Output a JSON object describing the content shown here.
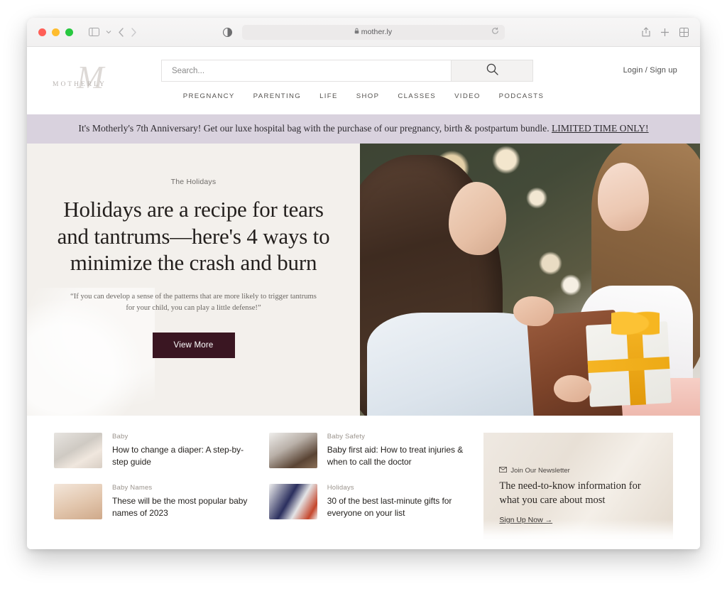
{
  "browser": {
    "url": "mother.ly",
    "lock_icon": "lock-icon",
    "reload_icon": "reload-icon",
    "sidebar_icon": "sidebar-toggle-icon",
    "chevron_icon": "chevron-down-icon",
    "back_icon": "back-arrow-icon",
    "forward_icon": "forward-arrow-icon",
    "shield_icon": "privacy-report-icon",
    "share_icon": "share-icon",
    "new_tab_icon": "plus-icon",
    "tab_overview_icon": "tab-overview-icon"
  },
  "site": {
    "logo": {
      "wordmark": "MOTHERLY",
      "monogram": "M"
    },
    "search": {
      "placeholder": "Search...",
      "value": "",
      "button_icon": "search-icon"
    },
    "account": {
      "label": "Login / Sign up"
    },
    "nav": [
      {
        "label": "PREGNANCY"
      },
      {
        "label": "PARENTING"
      },
      {
        "label": "LIFE"
      },
      {
        "label": "SHOP"
      },
      {
        "label": "CLASSES"
      },
      {
        "label": "VIDEO"
      },
      {
        "label": "PODCASTS"
      }
    ],
    "banner": {
      "text": "It's Motherly's 7th Anniversary! Get our luxe hospital bag with the purchase of our pregnancy, birth & postpartum bundle. ",
      "link": "LIMITED TIME ONLY!",
      "bg_color": "#d9d2de"
    },
    "hero": {
      "eyebrow": "The Holidays",
      "title": "Holidays are a recipe for tears and tantrums—here's 4 ways to minimize the crash and burn",
      "quote": "“If you can develop a sense of the patterns that are more likely to trigger tantrums for your child, you can play a little defense!”",
      "cta": "View More",
      "cta_color": "#3a1622",
      "bg_color": "#f3f0ec",
      "image_alt": "Mother and daughter beside a Christmas tree holding a gift with a yellow bow"
    },
    "articles_col1": [
      {
        "category": "Baby",
        "title": "How to change a diaper: A step-by-step guide",
        "thumb": "baby-diaper-thumb"
      },
      {
        "category": "Baby Names",
        "title": "These will be the most popular baby names of 2023",
        "thumb": "baby-smiling-thumb"
      }
    ],
    "articles_col2": [
      {
        "category": "Baby Safety",
        "title": "Baby first aid: How to treat injuries & when to call the doctor",
        "thumb": "baby-first-aid-thumb"
      },
      {
        "category": "Holidays",
        "title": "30 of the best last-minute gifts for everyone on your list",
        "thumb": "holiday-gifts-thumb"
      }
    ],
    "newsletter": {
      "eyebrow": "Join Our Newsletter",
      "icon": "envelope-icon",
      "headline": "The need-to-know information for what you care about most",
      "cta": "Sign Up Now →"
    }
  }
}
